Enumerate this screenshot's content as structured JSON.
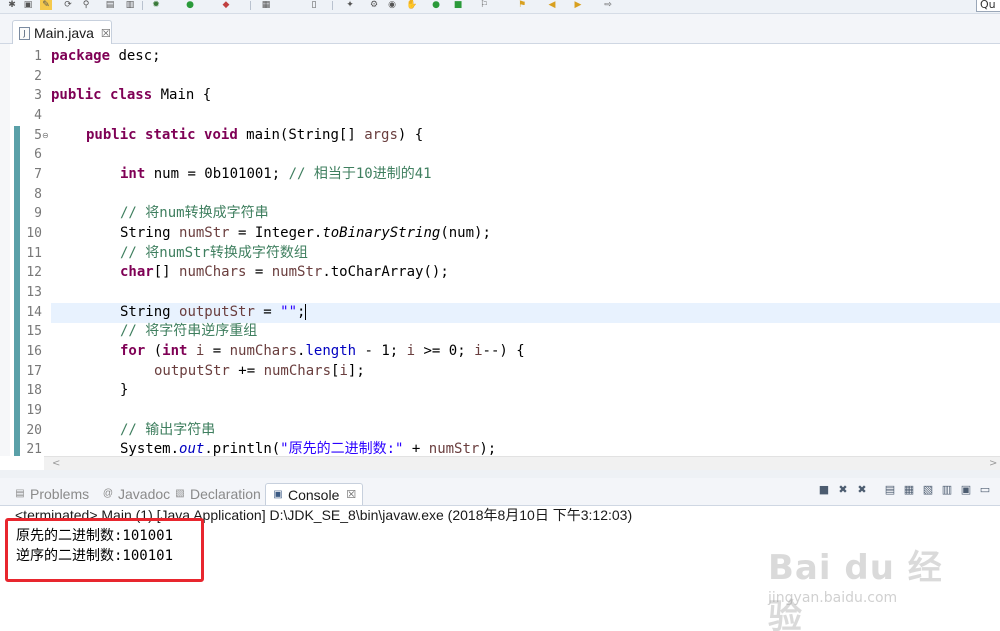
{
  "toolbar": {
    "icons": [
      "debug-icon",
      "run-icon",
      "external-tools-icon",
      "new-java-class-icon",
      "open-type-icon",
      "search-icon",
      "next-annotation-icon",
      "back-icon",
      "forward-icon"
    ],
    "quick_access": "Qu"
  },
  "editor": {
    "tab_label": "Main.java",
    "tab_close": "☒",
    "lines": [
      {
        "n": "1"
      },
      {
        "n": "2"
      },
      {
        "n": "3"
      },
      {
        "n": "4"
      },
      {
        "n": "5"
      },
      {
        "n": "6"
      },
      {
        "n": "7"
      },
      {
        "n": "8"
      },
      {
        "n": "9"
      },
      {
        "n": "10"
      },
      {
        "n": "11"
      },
      {
        "n": "12"
      },
      {
        "n": "13"
      },
      {
        "n": "14"
      },
      {
        "n": "15"
      },
      {
        "n": "16"
      },
      {
        "n": "17"
      },
      {
        "n": "18"
      },
      {
        "n": "19"
      },
      {
        "n": "20"
      },
      {
        "n": "21"
      }
    ],
    "code": {
      "l1_kw": "package",
      "l1_rest": " desc;",
      "l3_kw1": "public",
      "l3_kw2": "class",
      "l3_rest": " Main {",
      "l5_kw1": "public",
      "l5_kw2": "static",
      "l5_kw3": "void",
      "l5_mid": " main(String[] ",
      "l5_args": "args",
      "l5_end": ") {",
      "l7_kw": "int",
      "l7_mid": " num = 0b101001; ",
      "l7_cm": "// 相当于10进制的41",
      "l9_cm": "// 将num转换成字符串",
      "l10_a": "String ",
      "l10_var": "numStr",
      "l10_b": " = Integer.",
      "l10_m": "toBinaryString",
      "l10_c": "(num);",
      "l11_cm": "// 将numStr转换成字符数组",
      "l12_kw": "char",
      "l12_a": "[] ",
      "l12_var": "numChars",
      "l12_b": " = ",
      "l12_v2": "numStr",
      "l12_c": ".toCharArray();",
      "l14_a": "String ",
      "l14_var": "outputStr",
      "l14_b": " = ",
      "l14_str": "\"\"",
      "l14_c": ";",
      "l15_cm": "// 将字符串逆序重组",
      "l16_kw1": "for",
      "l16_a": " (",
      "l16_kw2": "int",
      "l16_var1": " i",
      "l16_b": " = ",
      "l16_v2": "numChars",
      "l16_c": ".",
      "l16_fld": "length",
      "l16_d": " - 1; ",
      "l16_v3": "i",
      "l16_e": " >= 0; ",
      "l16_v4": "i",
      "l16_f": "--) {",
      "l17_var": "outputStr",
      "l17_a": " += ",
      "l17_v2": "numChars",
      "l17_b": "[",
      "l17_v3": "i",
      "l17_c": "];",
      "l18": "}",
      "l20_cm": "// 输出字符串",
      "l21_a": "System.",
      "l21_fld": "out",
      "l21_b": ".println(",
      "l21_str": "\"原先的二进制数:\"",
      "l21_c": " + ",
      "l21_v": "numStr",
      "l21_d": ");"
    }
  },
  "views": {
    "tabs": [
      {
        "label": "Problems",
        "icon": "problems-icon"
      },
      {
        "label": "Javadoc",
        "icon": "javadoc-icon"
      },
      {
        "label": "Declaration",
        "icon": "declaration-icon"
      },
      {
        "label": "Console",
        "icon": "console-icon",
        "active": true
      }
    ],
    "close": "☒"
  },
  "console": {
    "status": "<terminated> Main (1) [Java Application] D:\\JDK_SE_8\\bin\\javaw.exe (2018年8月10日 下午3:12:03)",
    "output": [
      "原先的二进制数:101001",
      "逆序的二进制数:100101"
    ],
    "highlight_color": "#e8262e"
  },
  "watermark": {
    "logo": "Bai du 经验",
    "url": "jingyan.baidu.com"
  }
}
